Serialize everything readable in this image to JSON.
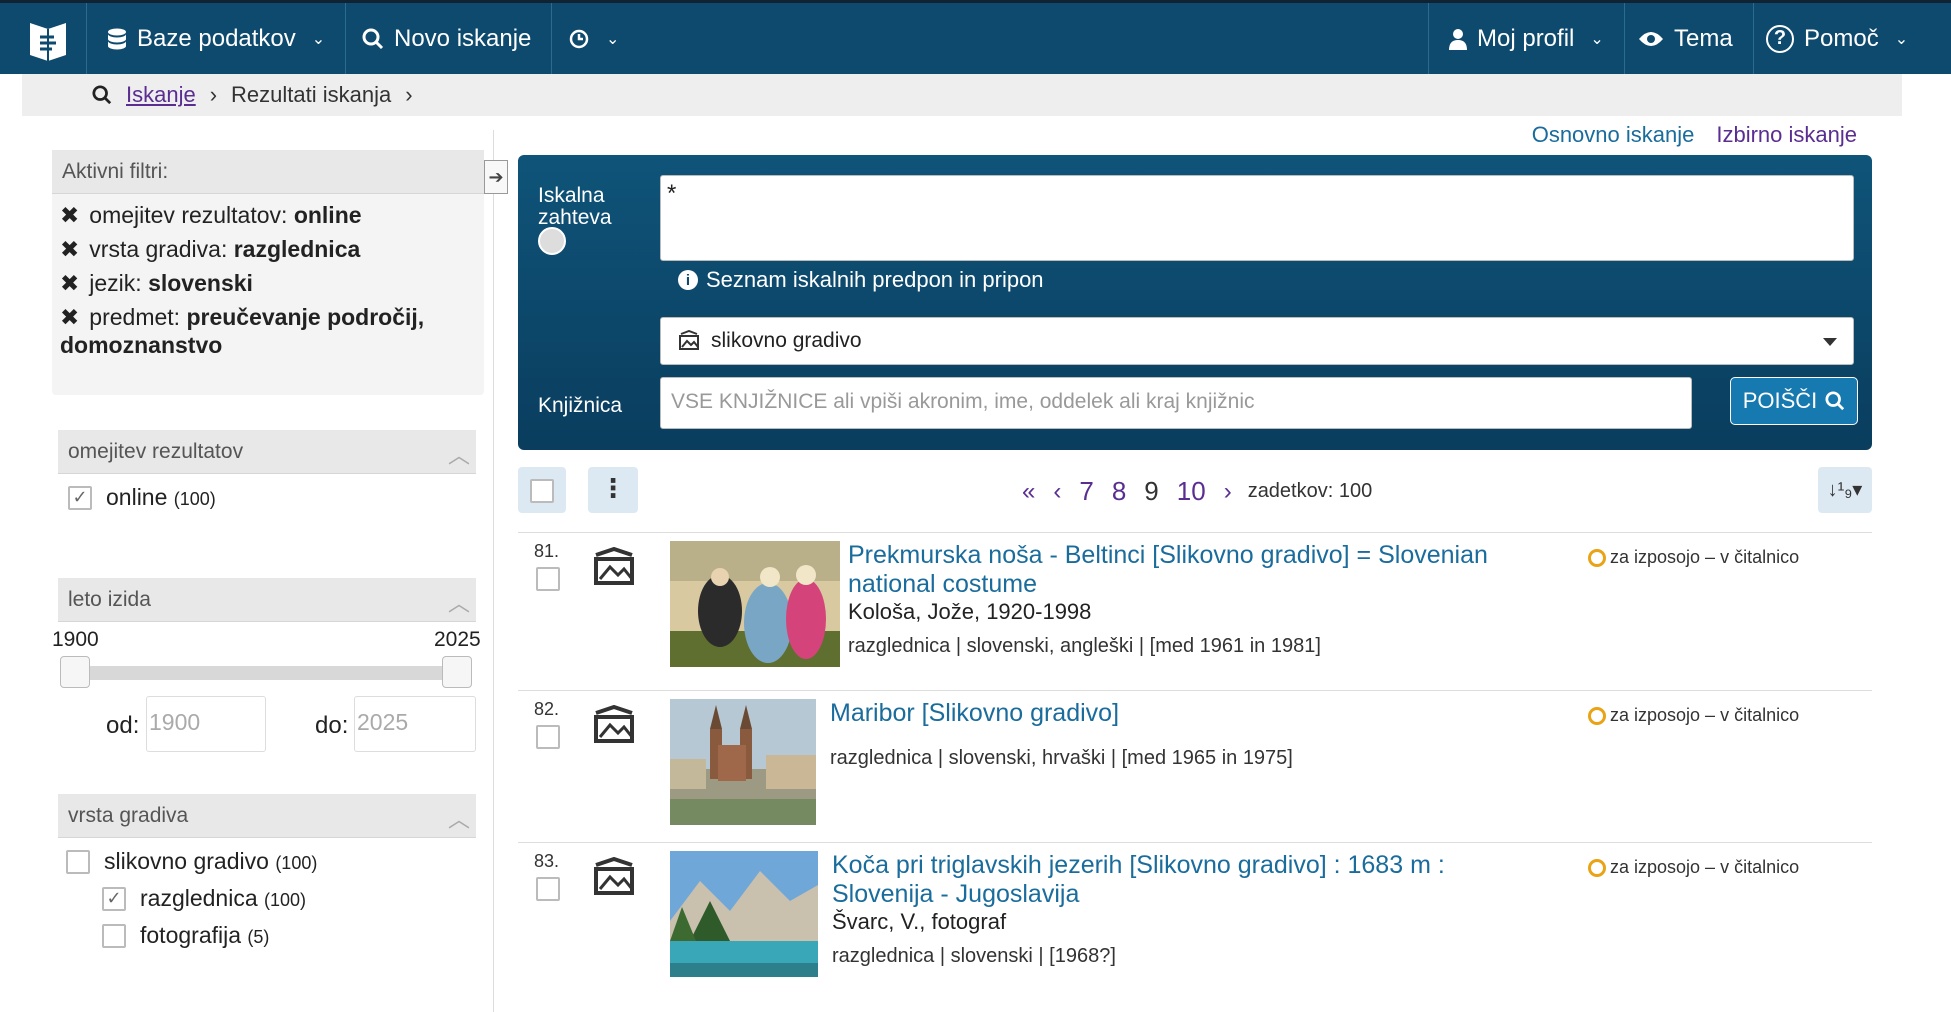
{
  "nav": {
    "databases_label": "Baze podatkov",
    "new_search_label": "Novo iskanje",
    "profile_label": "Moj profil",
    "theme_label": "Tema",
    "help_label": "Pomoč"
  },
  "breadcrumb": {
    "search_link": "Iskanje",
    "current": "Rezultati iskanja"
  },
  "active_filters": {
    "title": "Aktivni filtri:",
    "items": [
      {
        "key": "omejitev rezultatov:",
        "value": "online"
      },
      {
        "key": "vrsta gradiva:",
        "value": "razglednica"
      },
      {
        "key": "jezik:",
        "value": "slovenski"
      },
      {
        "key": "predmet:",
        "value": "preučevanje področij,",
        "value2": "domoznanstvo"
      }
    ]
  },
  "facets": {
    "restriction": {
      "title": "omejitev rezultatov",
      "options": [
        {
          "label": "online",
          "count": "(100)",
          "checked": true
        }
      ]
    },
    "year": {
      "title": "leto izida",
      "min_label": "1900",
      "max_label": "2025",
      "from_label": "od:",
      "to_label": "do:",
      "from_placeholder": "1900",
      "to_placeholder": "2025"
    },
    "material": {
      "title": "vrsta gradiva",
      "options": [
        {
          "label": "slikovno gradivo",
          "count": "(100)",
          "checked": false
        },
        {
          "label": "razglednica",
          "count": "(100)",
          "checked": true
        },
        {
          "label": "fotografija",
          "count": "(5)",
          "checked": false
        }
      ]
    }
  },
  "search": {
    "basic_link": "Osnovno iskanje",
    "advanced_link": "Izbirno iskanje",
    "query_label_1": "Iskalna",
    "query_label_2": "zahteva",
    "query_value": "*",
    "hint": "Seznam iskalnih predpon in pripon",
    "material_select": "slikovno gradivo",
    "library_label": "Knjižnica",
    "library_placeholder": "VSE KNJIŽNICE ali vpiši akronim, ime, oddelek ali kraj knjižnic",
    "search_button": "POIŠČI"
  },
  "pager": {
    "first": "«",
    "prev": "‹",
    "pages": [
      "7",
      "8",
      "9",
      "10"
    ],
    "current": "9",
    "next": "›",
    "count": "zadetkov: 100"
  },
  "results": [
    {
      "num": "81.",
      "title_1": "Prekmurska noša - Beltinci [Slikovno gradivo] = Slovenian",
      "title_2": "national costume",
      "author": "Kološa, Jože, 1920-1998",
      "meta": "razglednica | slovenski, angleški | [med 1961 in 1981]",
      "availability": "za izposojo – v čitalnico"
    },
    {
      "num": "82.",
      "title_1": "Maribor [Slikovno gradivo]",
      "title_2": "",
      "author": "",
      "meta": "razglednica | slovenski, hrvaški | [med 1965 in 1975]",
      "availability": "za izposojo – v čitalnico"
    },
    {
      "num": "83.",
      "title_1": "Koča pri triglavskih jezerih [Slikovno gradivo] : 1683 m :",
      "title_2": "Slovenija - Jugoslavija",
      "author": "Švarc, V., fotograf",
      "meta": "razglednica | slovenski | [1968?]",
      "availability": "za izposojo – v čitalnico"
    }
  ]
}
